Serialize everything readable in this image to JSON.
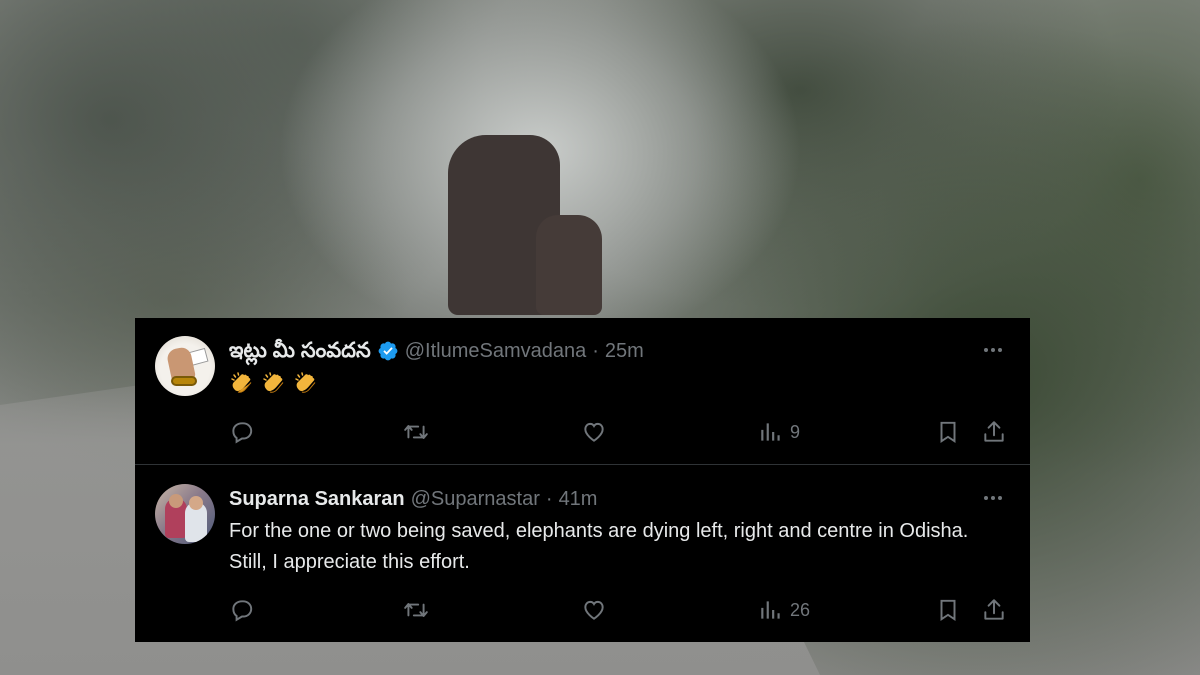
{
  "tweets": [
    {
      "display_name": "ఇట్లు మీ సంవదన",
      "verified": true,
      "handle": "@ItlumeSamvadana",
      "separator": "·",
      "time": "25m",
      "text": "",
      "emoji": [
        "clapping-hands",
        "clapping-hands",
        "clapping-hands"
      ],
      "views": "9"
    },
    {
      "display_name": "Suparna Sankaran",
      "verified": false,
      "handle": "@Suparnastar",
      "separator": "·",
      "time": "41m",
      "text": "For the one or two being saved, elephants are dying left, right and centre in Odisha. Still, I appreciate this effort.",
      "views": "26"
    }
  ],
  "icons": {
    "reply": "reply-icon",
    "retweet": "retweet-icon",
    "like": "like-icon",
    "views": "views-icon",
    "bookmark": "bookmark-icon",
    "share": "share-icon",
    "more": "more-icon",
    "verified": "verified-badge-icon"
  },
  "colors": {
    "panel_bg": "#000000",
    "text_primary": "#e7e9ea",
    "text_secondary": "#71767b",
    "verified_blue": "#1d9bf0",
    "divider": "#2f3336"
  }
}
